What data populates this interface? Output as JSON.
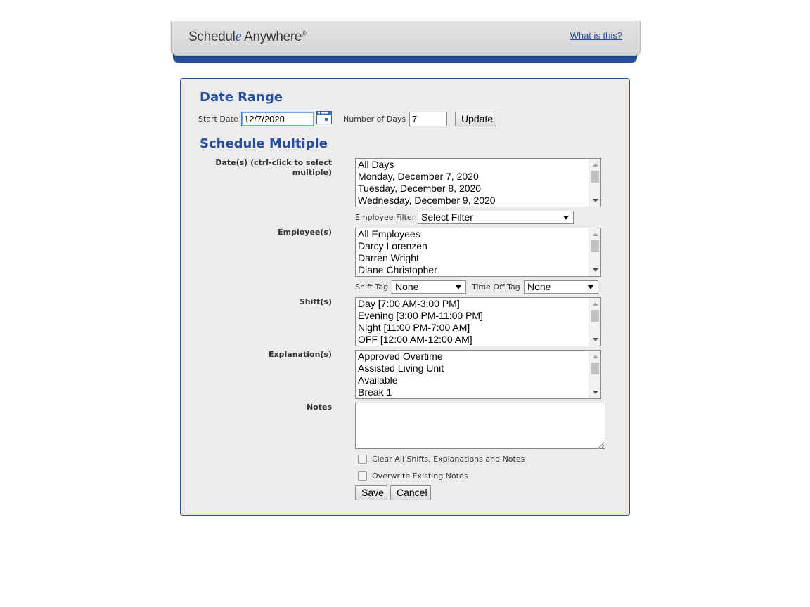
{
  "header": {
    "logo_part1": "Schedul",
    "logo_part2": "e",
    "logo_part3": " Anywhere",
    "logo_reg": "®",
    "help_link": "What is this?",
    "brand_blue": "#274f9c"
  },
  "date_range": {
    "title": "Date Range",
    "start_date_label": "Start Date",
    "start_date_value": "12/7/2020",
    "num_days_label": "Number of Days",
    "num_days_value": "7",
    "update_label": "Update"
  },
  "schedule_multiple": {
    "title": "Schedule Multiple",
    "dates_label": "Date(s) (ctrl-click to select multiple)",
    "dates_options": [
      "All Days",
      "Monday, December 7, 2020",
      "Tuesday, December 8, 2020",
      "Wednesday, December 9, 2020"
    ],
    "employee_filter_label": "Employee Filter",
    "employee_filter_value": "Select Filter",
    "employees_label": "Employee(s)",
    "employees_options": [
      "All Employees",
      "Darcy Lorenzen",
      "Darren Wright",
      "Diane Christopher"
    ],
    "shift_tag_label": "Shift Tag",
    "shift_tag_value": "None",
    "time_off_tag_label": "Time Off Tag",
    "time_off_tag_value": "None",
    "shifts_label": "Shift(s)",
    "shifts_options": [
      "Day [7:00 AM-3:00 PM]",
      "Evening [3:00 PM-11:00 PM]",
      "Night [11:00 PM-7:00 AM]",
      "OFF [12:00 AM-12:00 AM]"
    ],
    "explanations_label": "Explanation(s)",
    "explanations_options": [
      "Approved Overtime",
      "Assisted Living Unit",
      "Available",
      "Break 1"
    ],
    "notes_label": "Notes",
    "notes_value": "",
    "clear_all_label": "Clear All Shifts, Explanations and Notes",
    "clear_all_checked": false,
    "overwrite_label": "Overwrite Existing Notes",
    "overwrite_checked": false,
    "save_label": "Save",
    "cancel_label": "Cancel"
  },
  "icons": {
    "calendar": "calendar-icon",
    "scroll_up": "scroll-up-arrow-icon",
    "scroll_down": "scroll-down-arrow-icon",
    "dropdown": "chevron-down-icon"
  }
}
